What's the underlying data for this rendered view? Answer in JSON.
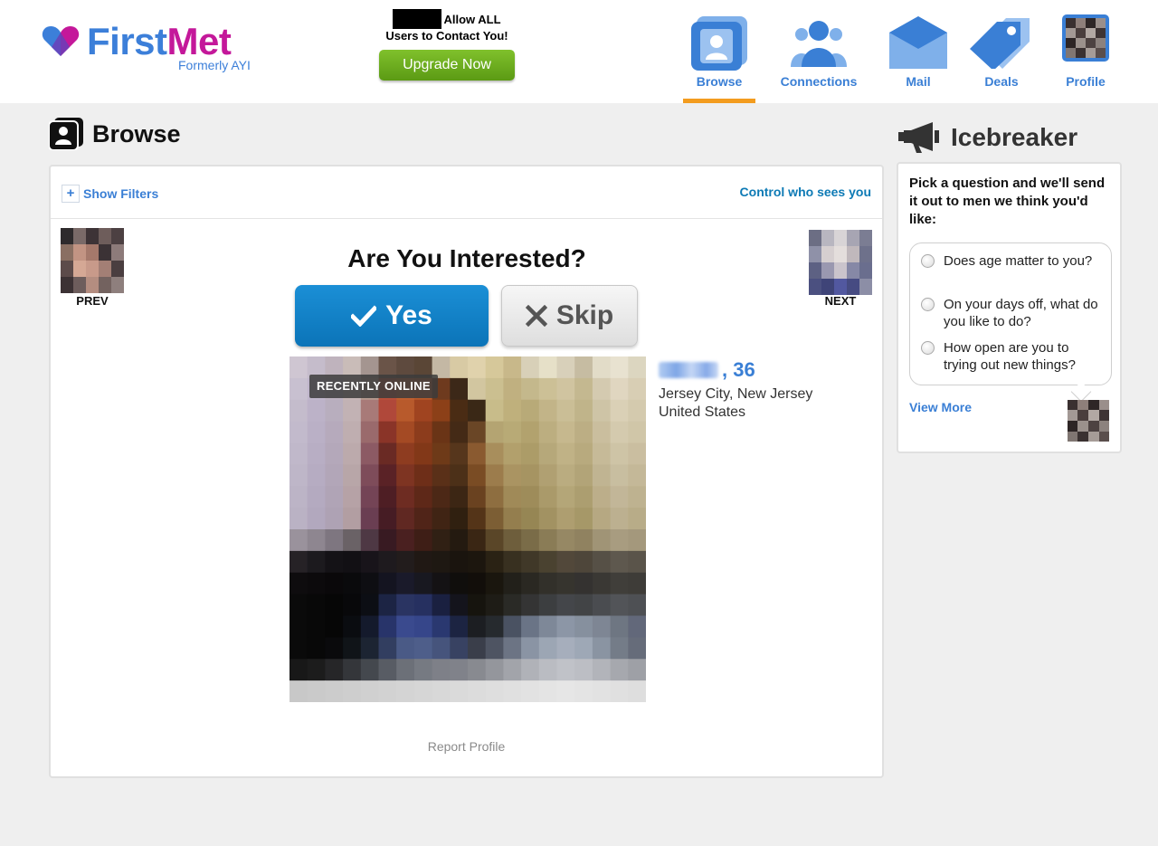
{
  "header": {
    "logo": {
      "first": "First",
      "met": "Met",
      "subtitle": "Formerly AYI"
    },
    "promo": {
      "line1": "Allow ALL",
      "line2": "Users to Contact You!",
      "upgrade_label": "Upgrade Now"
    },
    "nav": [
      {
        "label": "Browse",
        "icon": "browse-icon",
        "active": true
      },
      {
        "label": "Connections",
        "icon": "connections-icon",
        "active": false
      },
      {
        "label": "Mail",
        "icon": "mail-icon",
        "active": false
      },
      {
        "label": "Deals",
        "icon": "deals-icon",
        "active": false
      },
      {
        "label": "Profile",
        "icon": "profile-avatar",
        "active": false
      }
    ]
  },
  "browse": {
    "title": "Browse",
    "show_filters": "Show Filters",
    "control_link": "Control who sees you",
    "prev_label": "PREV",
    "next_label": "NEXT",
    "question": "Are You Interested?",
    "yes_label": "Yes",
    "skip_label": "Skip",
    "badge": "RECENTLY ONLINE",
    "member": {
      "age_text": ", 36",
      "location_line1": "Jersey City, New Jersey",
      "location_line2": "United States"
    },
    "report": "Report Profile"
  },
  "icebreaker": {
    "title": "Icebreaker",
    "prompt": "Pick a question and we'll send it out to men we think you'd like:",
    "options": [
      "Does age matter to you?",
      "On your days off, what do you like to do?",
      "How open are you to trying out new things?"
    ],
    "view_more": "View More"
  },
  "colors": {
    "brand_blue": "#3a7fd5",
    "brand_magenta": "#c4189a",
    "nav_active_bar": "#f39c1f",
    "yes_button": "#0b74b8",
    "upgrade_green": "#5b9a14"
  }
}
